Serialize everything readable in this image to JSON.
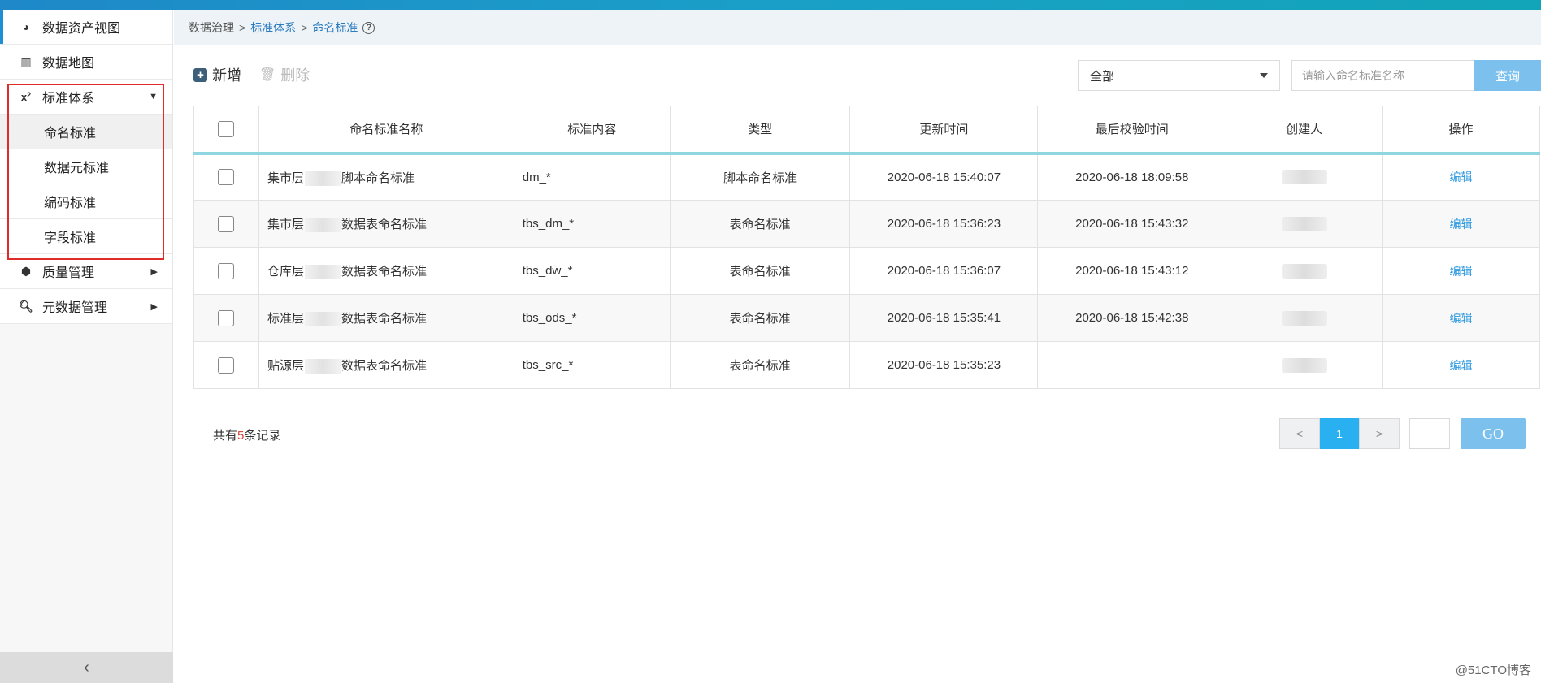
{
  "sidebar": {
    "items": [
      {
        "label": "数据资产视图",
        "icon": "pie-chart-icon"
      },
      {
        "label": "数据地图",
        "icon": "map-icon"
      },
      {
        "label": "标准体系",
        "icon": "subscript-icon"
      },
      {
        "label": "质量管理",
        "icon": "cube-icon"
      },
      {
        "label": "元数据管理",
        "icon": "search-icon"
      }
    ],
    "sub_items": [
      {
        "label": "命名标准"
      },
      {
        "label": "数据元标准"
      },
      {
        "label": "编码标准"
      },
      {
        "label": "字段标准"
      }
    ]
  },
  "breadcrumb": {
    "root": "数据治理",
    "level2": "标准体系",
    "current": "命名标准"
  },
  "toolbar": {
    "add_label": "新增",
    "delete_label": "删除"
  },
  "filter": {
    "selected": "全部",
    "search_placeholder": "请输入命名标准名称",
    "query_label": "查询"
  },
  "table": {
    "headers": [
      "命名标准名称",
      "标准内容",
      "类型",
      "更新时间",
      "最后校验时间",
      "创建人",
      "操作"
    ],
    "rows": [
      {
        "name_prefix": "集市层",
        "name_suffix": "脚本命名标准",
        "content": "dm_*",
        "type": "脚本命名标准",
        "updated": "2020-06-18 15:40:07",
        "checked": "2020-06-18 18:09:58",
        "action": "编辑"
      },
      {
        "name_prefix": "集市层",
        "name_suffix": "数据表命名标准",
        "content": "tbs_dm_*",
        "type": "表命名标准",
        "updated": "2020-06-18 15:36:23",
        "checked": "2020-06-18 15:43:32",
        "action": "编辑"
      },
      {
        "name_prefix": "仓库层",
        "name_suffix": "数据表命名标准",
        "content": "tbs_dw_*",
        "type": "表命名标准",
        "updated": "2020-06-18 15:36:07",
        "checked": "2020-06-18 15:43:12",
        "action": "编辑"
      },
      {
        "name_prefix": "标准层",
        "name_suffix": "数据表命名标准",
        "content": "tbs_ods_*",
        "type": "表命名标准",
        "updated": "2020-06-18 15:35:41",
        "checked": "2020-06-18 15:42:38",
        "action": "编辑"
      },
      {
        "name_prefix": "贴源层",
        "name_suffix": "数据表命名标准",
        "content": "tbs_src_*",
        "type": "表命名标准",
        "updated": "2020-06-18 15:35:23",
        "checked": "",
        "action": "编辑"
      }
    ]
  },
  "footer": {
    "record_prefix": "共有",
    "record_count": "5",
    "record_suffix": "条记录",
    "prev": "<",
    "current_page": "1",
    "next": ">",
    "go_label": "GO"
  },
  "watermark": "@51CTO博客"
}
